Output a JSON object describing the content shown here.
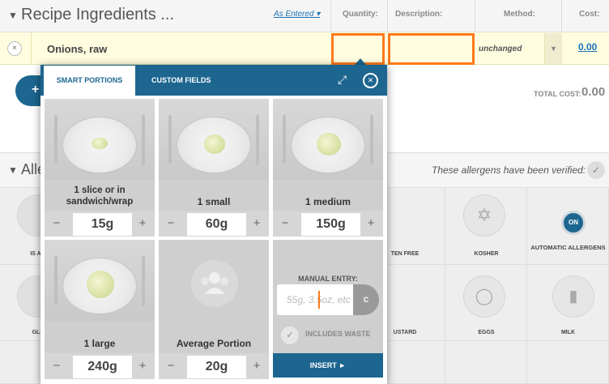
{
  "header": {
    "title": "Recipe Ingredients ...",
    "as_entered": "As Entered",
    "columns": {
      "quantity": "Quantity:",
      "description": "Description:",
      "method": "Method:",
      "cost": "Cost:"
    }
  },
  "ingredient_row": {
    "remove_label": "×",
    "name": "Onions, raw",
    "method": "unchanged",
    "cost": "0.00"
  },
  "summary": {
    "add_label": "+",
    "total_cost_label": "TOTAL COST:",
    "total_cost_value": "0.00"
  },
  "allergens": {
    "title": "Alle",
    "verified_text": "These allergens have been verified:",
    "tiles": [
      "IS A L",
      "TEN FREE",
      "KOSHER",
      "AUTOMATIC ALLERGENS",
      "GLU",
      "USTARD",
      "EGGS",
      "MILK"
    ],
    "on_badge": "ON"
  },
  "popup": {
    "tabs": [
      "SMART PORTIONS",
      "CUSTOM FIELDS"
    ],
    "portions": [
      {
        "label": "1 slice or in sandwich/wrap",
        "value": "15g"
      },
      {
        "label": "1 small",
        "value": "60g"
      },
      {
        "label": "1 medium",
        "value": "150g"
      },
      {
        "label": "1 large",
        "value": "240g"
      },
      {
        "label": "Average Portion",
        "value": "20g"
      }
    ],
    "minus": "−",
    "plus": "+",
    "manual_entry_label": "MANUAL ENTRY:",
    "manual_placeholder": "55g, 3.5oz, etc",
    "clear_label": "C",
    "includes_waste": "INCLUDES WASTE",
    "insert_label": "INSERT ►"
  },
  "icons": {
    "expand": "expand-icon",
    "close": "close-icon",
    "check": "check-icon"
  }
}
